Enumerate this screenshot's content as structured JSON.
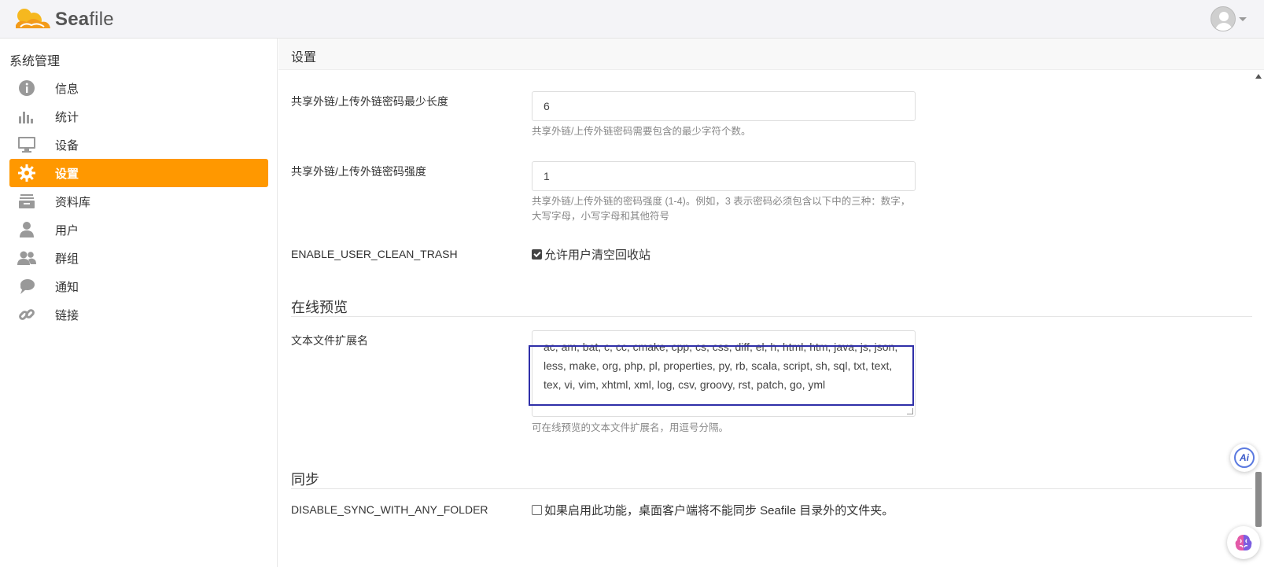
{
  "app": {
    "brand_prefix": "Sea",
    "brand_suffix": "file"
  },
  "sidebar": {
    "title": "系统管理",
    "items": [
      {
        "label": "信息",
        "icon": "info-icon"
      },
      {
        "label": "统计",
        "icon": "bar-chart-icon"
      },
      {
        "label": "设备",
        "icon": "monitor-icon"
      },
      {
        "label": "设置",
        "icon": "gear-icon",
        "active": true
      },
      {
        "label": "资料库",
        "icon": "library-icon"
      },
      {
        "label": "用户",
        "icon": "user-icon"
      },
      {
        "label": "群组",
        "icon": "group-icon"
      },
      {
        "label": "通知",
        "icon": "notification-icon"
      },
      {
        "label": "链接",
        "icon": "link-icon"
      }
    ]
  },
  "main": {
    "title": "设置",
    "settings": {
      "min_length": {
        "label": "共享外链/上传外链密码最少长度",
        "value": "6",
        "help": "共享外链/上传外链密码需要包含的最少字符个数。"
      },
      "strength": {
        "label": "共享外链/上传外链密码强度",
        "value": "1",
        "help": "共享外链/上传外链的密码强度 (1-4)。例如，3 表示密码必须包含以下中的三种：数字，大写字母，小写字母和其他符号"
      },
      "clean_trash": {
        "label": "ENABLE_USER_CLEAN_TRASH",
        "checkbox_label": "允许用户清空回收站",
        "checked": true
      }
    },
    "preview_section": {
      "title": "在线预览",
      "text_ext": {
        "label": "文本文件扩展名",
        "value": "ac, am, bat, c, cc, cmake, cpp, cs, css, diff, el, h, html, htm, java, js, json, less, make, org, php, pl, properties, py, rb, scala, script, sh, sql, txt, text, tex, vi, vim, xhtml, xml, log, csv, groovy, rst, patch, go, yml",
        "help": "可在线预览的文本文件扩展名，用逗号分隔。"
      }
    },
    "sync_section": {
      "title": "同步",
      "disable_sync": {
        "label": "DISABLE_SYNC_WITH_ANY_FOLDER",
        "checkbox_label": "如果启用此功能，桌面客户端将不能同步 Seafile 目录外的文件夹。",
        "checked": false
      }
    }
  },
  "colors": {
    "accent": "#ff9800",
    "focus": "#2f2fa8"
  },
  "floating": {
    "ai_label": "Ai"
  }
}
